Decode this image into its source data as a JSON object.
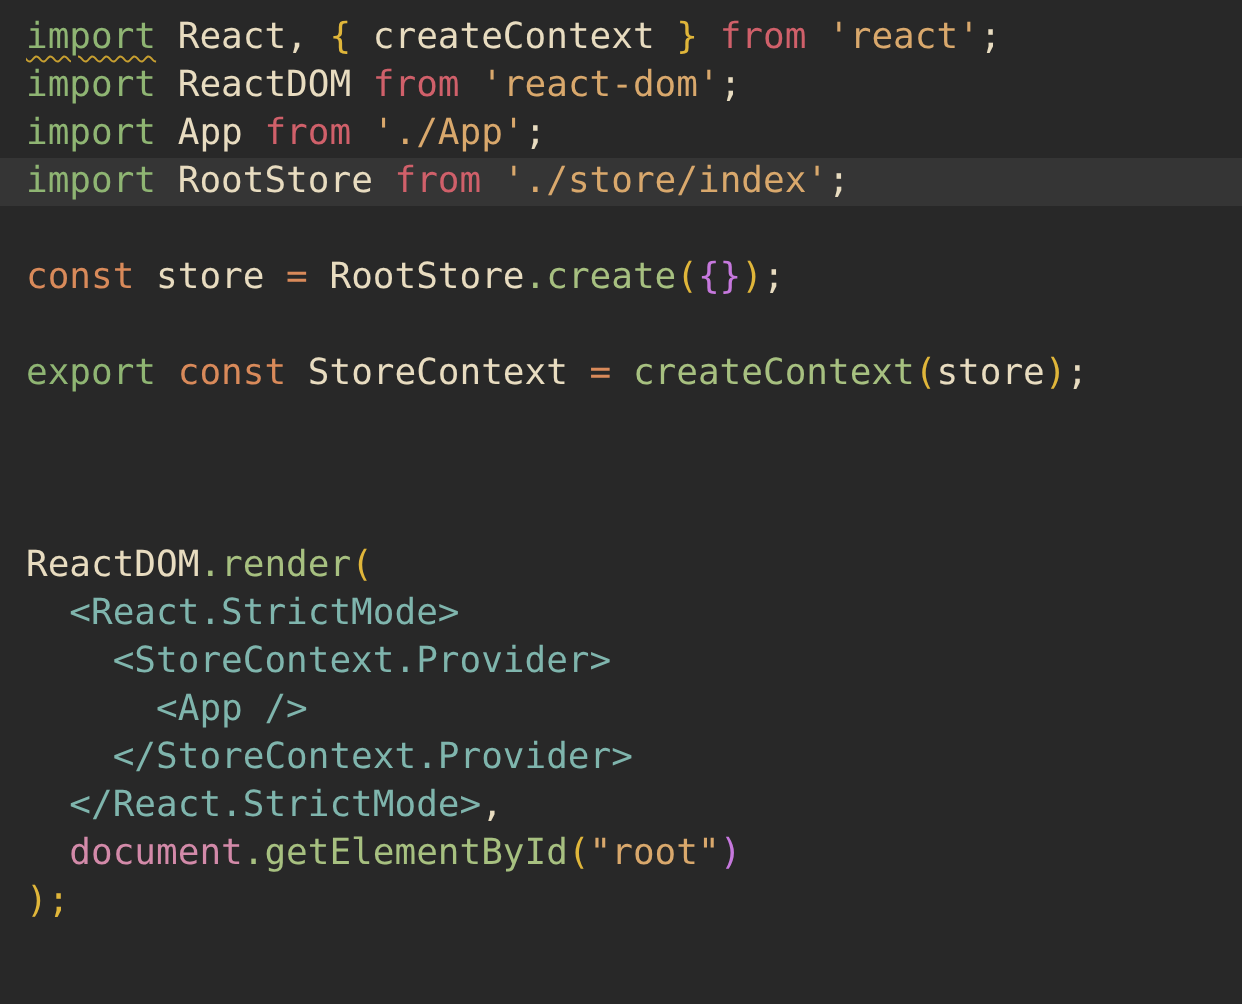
{
  "editor": {
    "lines": [
      {
        "kind": "code",
        "highlighted": false,
        "tokens": [
          {
            "text": "import",
            "kind": "keyword",
            "squiggle": true
          },
          {
            "text": " React, ",
            "kind": "ident"
          },
          {
            "text": "{",
            "kind": "brace"
          },
          {
            "text": " createContext ",
            "kind": "ident"
          },
          {
            "text": "}",
            "kind": "brace"
          },
          {
            "text": " from ",
            "kind": "from"
          },
          {
            "text": "'react'",
            "kind": "string"
          },
          {
            "text": ";",
            "kind": "ident"
          }
        ]
      },
      {
        "kind": "code",
        "highlighted": false,
        "tokens": [
          {
            "text": "import",
            "kind": "keyword"
          },
          {
            "text": " ReactDOM ",
            "kind": "ident"
          },
          {
            "text": "from",
            "kind": "from"
          },
          {
            "text": " 'react-dom'",
            "kind": "string"
          },
          {
            "text": ";",
            "kind": "ident"
          }
        ]
      },
      {
        "kind": "code",
        "highlighted": false,
        "tokens": [
          {
            "text": "import",
            "kind": "keyword"
          },
          {
            "text": " App ",
            "kind": "ident"
          },
          {
            "text": "from",
            "kind": "from"
          },
          {
            "text": " './App'",
            "kind": "string"
          },
          {
            "text": ";",
            "kind": "ident"
          }
        ]
      },
      {
        "kind": "code",
        "highlighted": true,
        "tokens": [
          {
            "text": "import",
            "kind": "keyword"
          },
          {
            "text": " RootStore ",
            "kind": "ident"
          },
          {
            "text": "from",
            "kind": "from"
          },
          {
            "text": " './store/index'",
            "kind": "string"
          },
          {
            "text": ";",
            "kind": "ident"
          }
        ]
      },
      {
        "kind": "blank"
      },
      {
        "kind": "code",
        "highlighted": false,
        "tokens": [
          {
            "text": "const",
            "kind": "storage"
          },
          {
            "text": " store ",
            "kind": "ident"
          },
          {
            "text": "=",
            "kind": "storage"
          },
          {
            "text": " RootStore",
            "kind": "ident"
          },
          {
            "text": ".create",
            "kind": "function"
          },
          {
            "text": "(",
            "kind": "brace"
          },
          {
            "text": "{}",
            "kind": "brace2"
          },
          {
            "text": ")",
            "kind": "brace"
          },
          {
            "text": ";",
            "kind": "ident"
          }
        ]
      },
      {
        "kind": "blank"
      },
      {
        "kind": "code",
        "highlighted": false,
        "tokens": [
          {
            "text": "export",
            "kind": "keyword"
          },
          {
            "text": " const",
            "kind": "storage"
          },
          {
            "text": " StoreContext ",
            "kind": "ident"
          },
          {
            "text": "=",
            "kind": "storage"
          },
          {
            "text": " createContext",
            "kind": "function"
          },
          {
            "text": "(",
            "kind": "brace"
          },
          {
            "text": "store",
            "kind": "ident"
          },
          {
            "text": ")",
            "kind": "brace"
          },
          {
            "text": ";",
            "kind": "ident"
          }
        ]
      },
      {
        "kind": "blank"
      },
      {
        "kind": "blank"
      },
      {
        "kind": "blank"
      },
      {
        "kind": "code",
        "highlighted": false,
        "tokens": [
          {
            "text": "ReactDOM",
            "kind": "ident"
          },
          {
            "text": ".render",
            "kind": "function"
          },
          {
            "text": "(",
            "kind": "brace"
          }
        ]
      },
      {
        "kind": "code",
        "highlighted": false,
        "tokens": [
          {
            "text": "  <React.StrictMode>",
            "kind": "tag"
          }
        ]
      },
      {
        "kind": "code",
        "highlighted": false,
        "tokens": [
          {
            "text": "    <StoreContext.Provider>",
            "kind": "tag"
          }
        ]
      },
      {
        "kind": "code",
        "highlighted": false,
        "tokens": [
          {
            "text": "      <App />",
            "kind": "tag"
          }
        ]
      },
      {
        "kind": "code",
        "highlighted": false,
        "tokens": [
          {
            "text": "    </StoreContext.Provider>",
            "kind": "tag"
          }
        ]
      },
      {
        "kind": "code",
        "highlighted": false,
        "tokens": [
          {
            "text": "  </React.StrictMode>",
            "kind": "tag"
          },
          {
            "text": ",",
            "kind": "ident"
          }
        ]
      },
      {
        "kind": "code",
        "highlighted": false,
        "tokens": [
          {
            "text": "  document",
            "kind": "builtin"
          },
          {
            "text": ".getElementById",
            "kind": "function"
          },
          {
            "text": "(",
            "kind": "brace"
          },
          {
            "text": "\"root\"",
            "kind": "string"
          },
          {
            "text": ")",
            "kind": "brace2"
          }
        ]
      },
      {
        "kind": "code",
        "highlighted": false,
        "tokens": [
          {
            "text": ");",
            "kind": "brace"
          }
        ]
      }
    ]
  }
}
